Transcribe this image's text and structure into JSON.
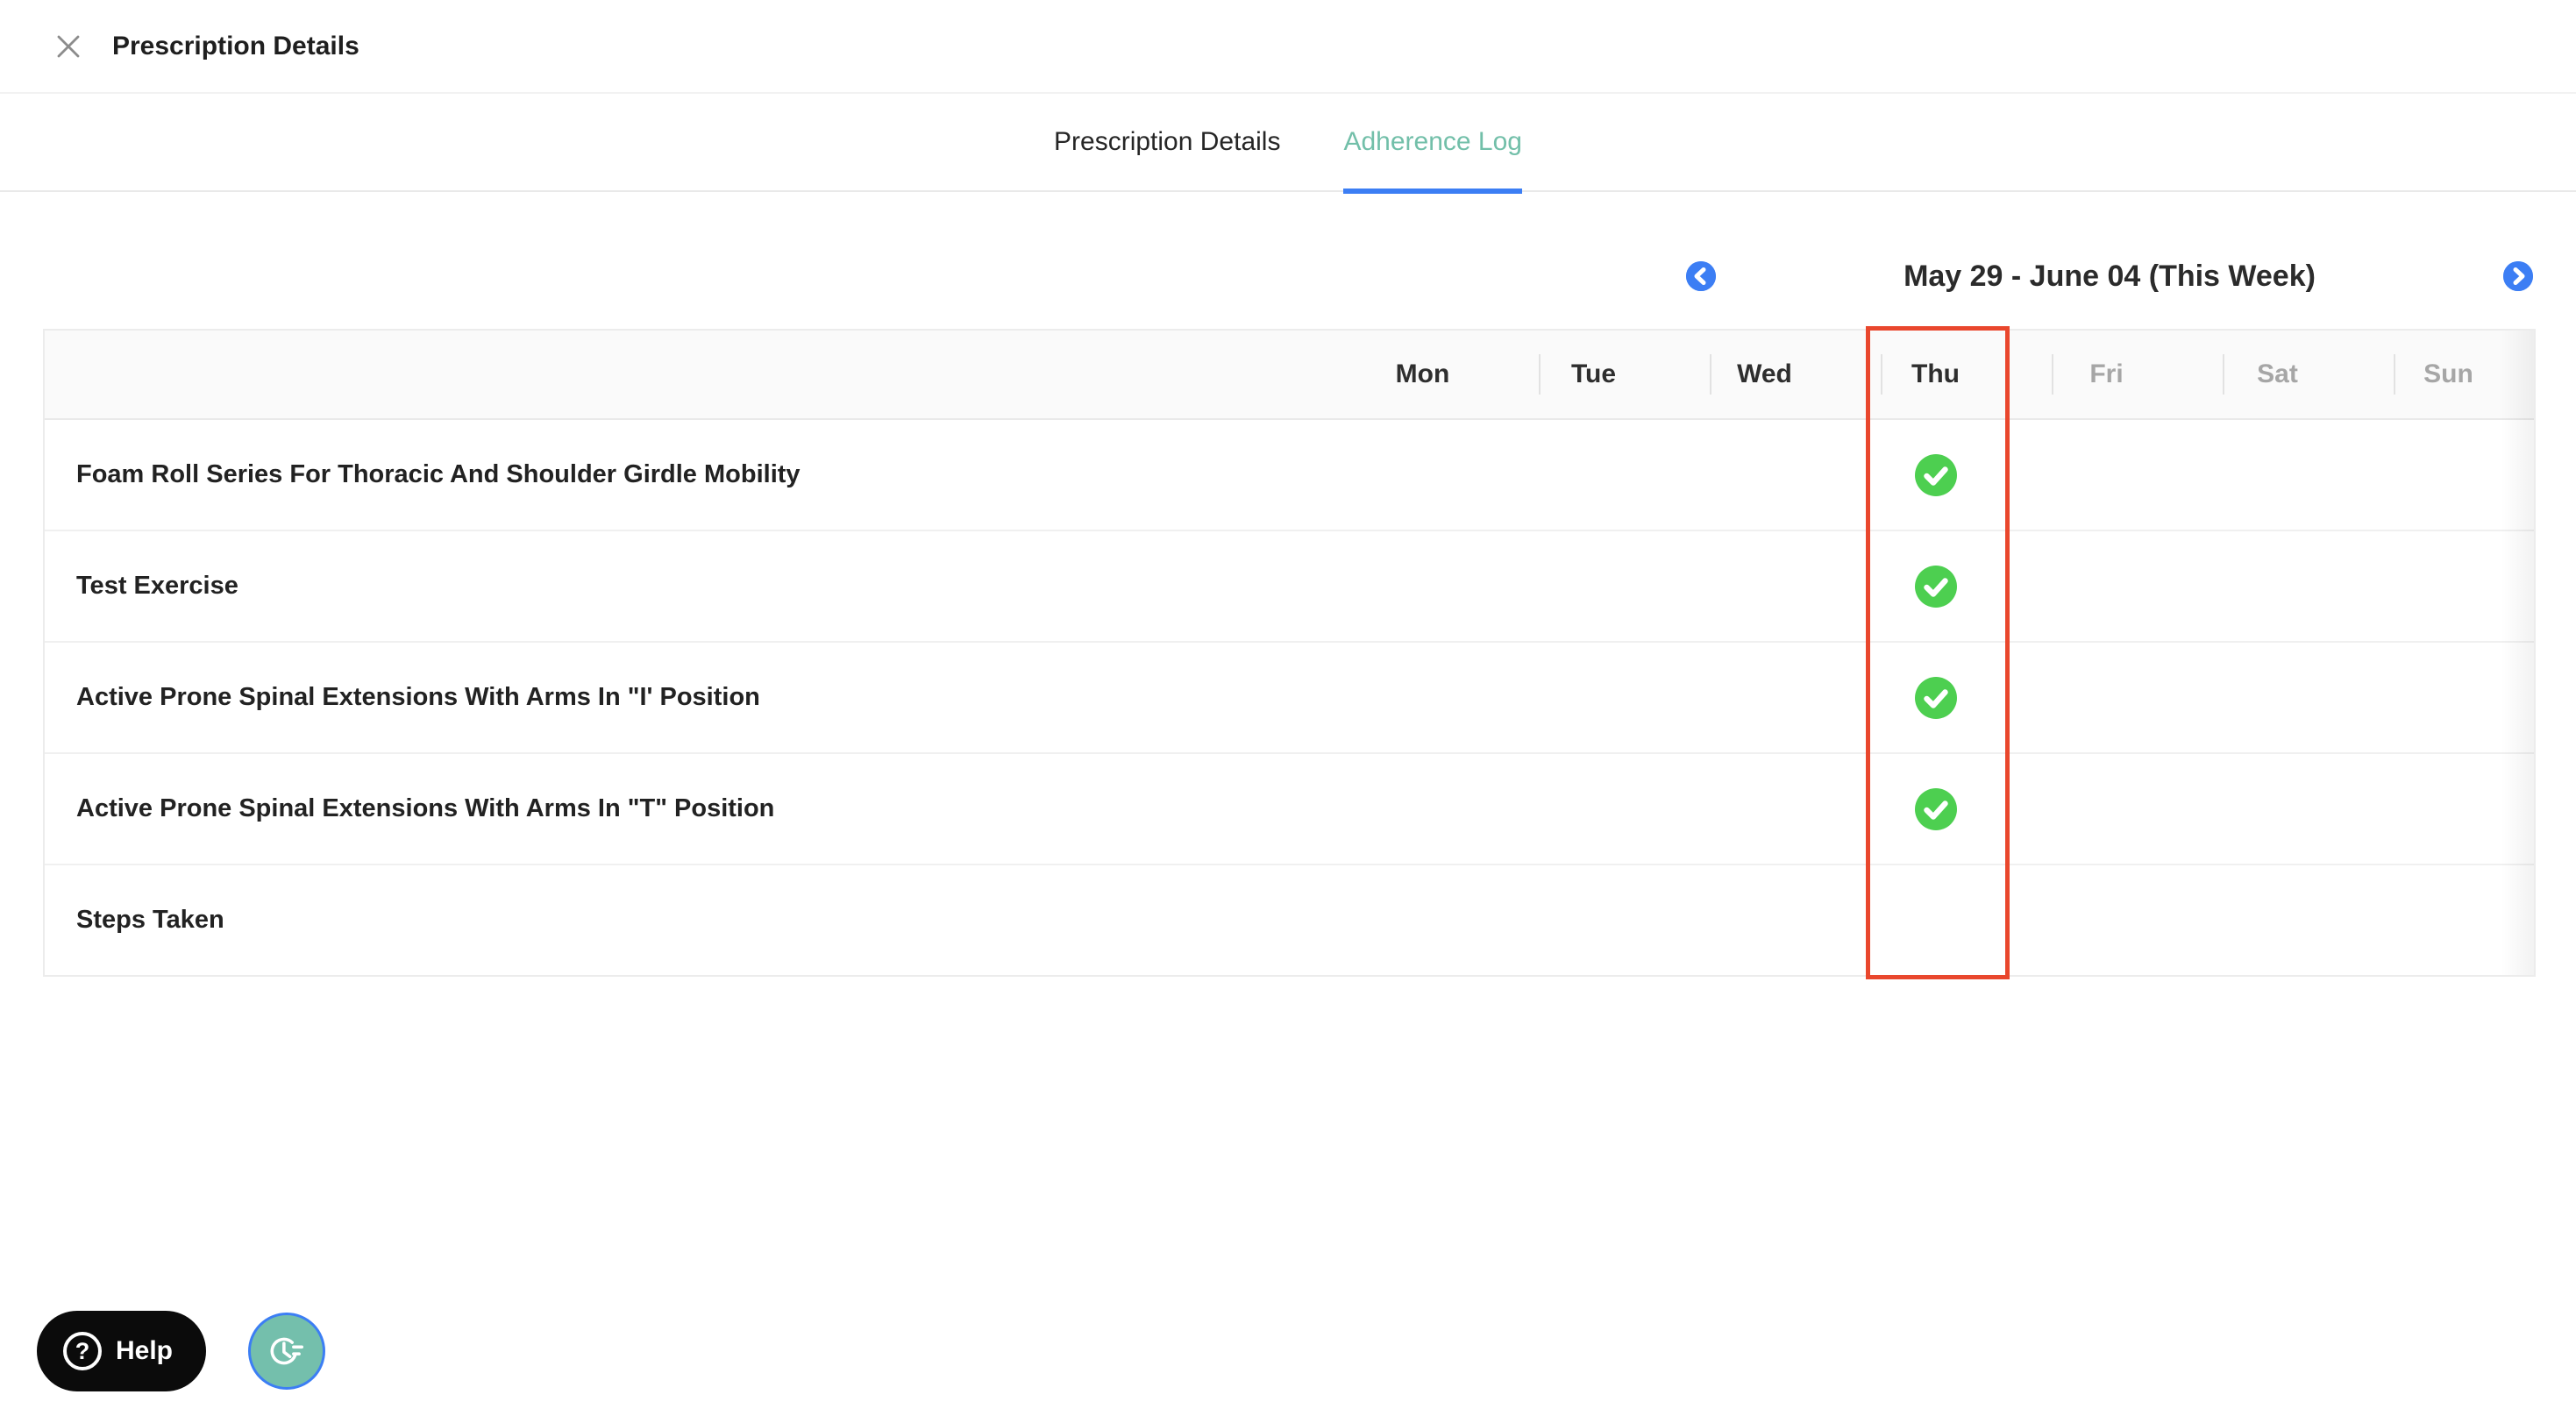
{
  "colors": {
    "accent_blue": "#3C7EF4",
    "tab_active_teal": "#72BFA9",
    "check_green": "#4DCF50",
    "highlight_red": "#E9472D",
    "fab_teal": "#74BFAC",
    "muted_gray": "#A6A6A6"
  },
  "header": {
    "title": "Prescription Details",
    "close_icon": "x"
  },
  "tabs": [
    {
      "label": "Prescription Details",
      "active": false
    },
    {
      "label": "Adherence Log",
      "active": true
    }
  ],
  "week_nav": {
    "prev_icon": "chevron-left",
    "title": "May 29 - June 04 (This Week)",
    "next_icon": "chevron-right"
  },
  "adherence_table": {
    "days": [
      {
        "label": "Mon",
        "emphasis": "strong"
      },
      {
        "label": "Tue",
        "emphasis": "strong"
      },
      {
        "label": "Wed",
        "emphasis": "strong"
      },
      {
        "label": "Thu",
        "emphasis": "strong"
      },
      {
        "label": "Fri",
        "emphasis": "muted"
      },
      {
        "label": "Sat",
        "emphasis": "muted"
      },
      {
        "label": "Sun",
        "emphasis": "muted"
      }
    ],
    "highlighted_day": "Thu",
    "rows": [
      {
        "label": "Foam Roll Series For Thoracic And Shoulder Girdle Mobility",
        "completed_days": [
          "Thu"
        ]
      },
      {
        "label": "Test Exercise",
        "completed_days": [
          "Thu"
        ]
      },
      {
        "label": "Active Prone Spinal Extensions With Arms In \"I' Position",
        "completed_days": [
          "Thu"
        ]
      },
      {
        "label": "Active Prone Spinal Extensions With Arms In \"T\" Position",
        "completed_days": [
          "Thu"
        ]
      },
      {
        "label": "Steps Taken",
        "completed_days": []
      }
    ],
    "completed_icon": "check-circle-green"
  },
  "footer": {
    "help_label": "Help",
    "help_icon": "?",
    "fab_icon": "clock-history"
  }
}
